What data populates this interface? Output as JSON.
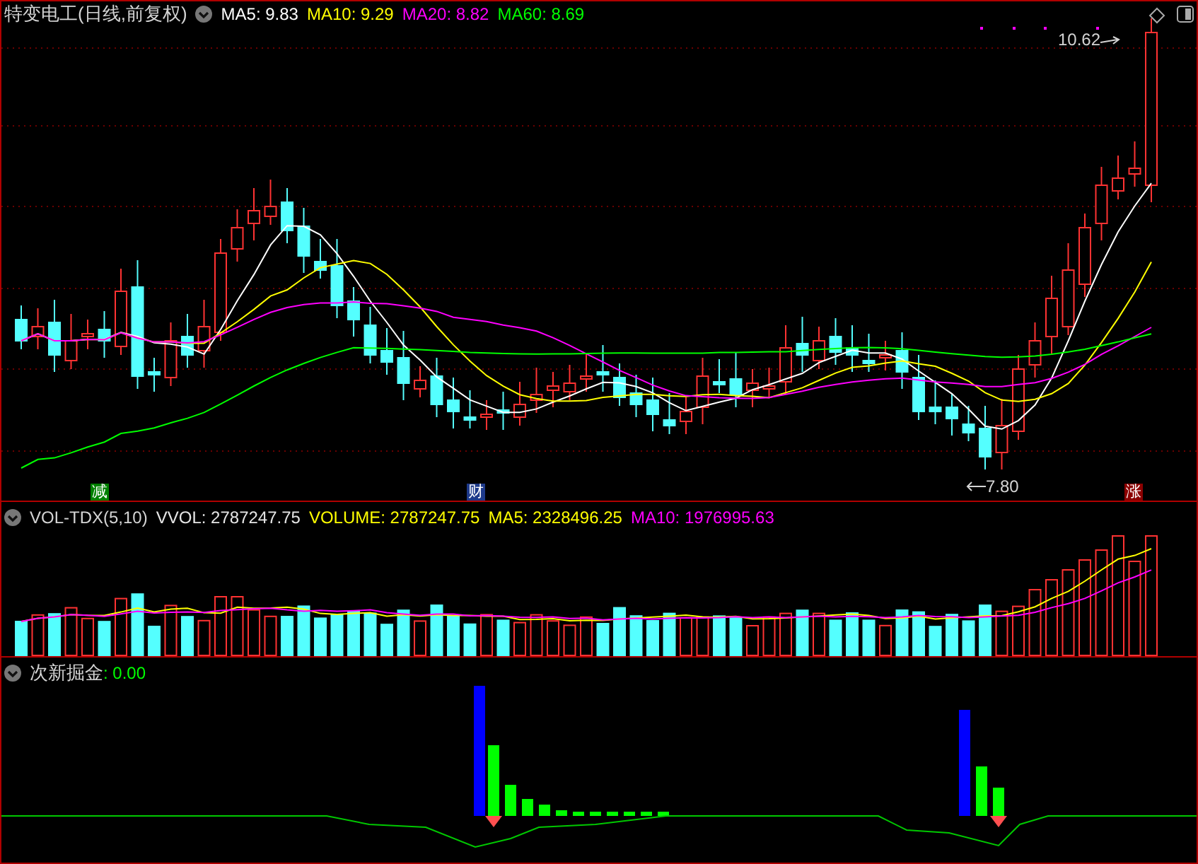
{
  "stock_panel": {
    "title": "特变电工(日线,前复权)",
    "indicators": [
      {
        "label": "MA5: 9.83",
        "color": "#ffffff"
      },
      {
        "label": "MA10: 9.29",
        "color": "#ffff00"
      },
      {
        "label": "MA20: 8.82",
        "color": "#ff00ff"
      },
      {
        "label": "MA60: 8.69",
        "color": "#00ff00"
      }
    ],
    "price_labels": [
      {
        "kind": "high",
        "text": "10.62"
      },
      {
        "kind": "low",
        "text": "7.80"
      }
    ],
    "markers": [
      {
        "text": "减",
        "color": "#008000"
      },
      {
        "text": "财",
        "color": "#1e3a8a"
      },
      {
        "text": "涨",
        "color": "#8b0000"
      }
    ]
  },
  "volume_panel": {
    "title": "VOL-TDX(5,10)",
    "readings": [
      {
        "label": "VVOL: 2787247.75",
        "color": "#e5e5e5"
      },
      {
        "label": "VOLUME: 2787247.75",
        "color": "#ffff00"
      },
      {
        "label": "MA5: 2328496.25",
        "color": "#ffff00"
      },
      {
        "label": "MA10: 1976995.63",
        "color": "#ff00ff"
      }
    ]
  },
  "indicator_panel": {
    "title": "次新掘金",
    "readings": [
      {
        "label": ": 0.00",
        "color": "#00ff00"
      }
    ]
  }
}
